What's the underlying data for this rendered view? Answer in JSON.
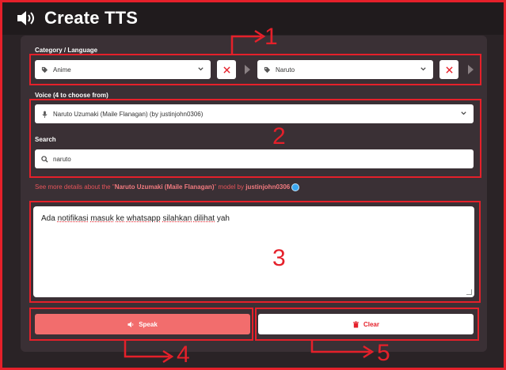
{
  "header": {
    "title": "Create TTS",
    "icon": "speaker-icon"
  },
  "category": {
    "label": "Category / Language",
    "category_value": "Anime",
    "subcategory_value": "Naruto"
  },
  "voice": {
    "label": "Voice (4 to choose from)",
    "value": "Naruto Uzumaki (Maile Flanagan) (by justinjohn0306)"
  },
  "search": {
    "label": "Search",
    "value": "naruto"
  },
  "details": {
    "prefix": "See more details about the \"",
    "model_name": "Naruto Uzumaki (Maile Flanagan)",
    "middle": "\" model by ",
    "owner": "justinjohn0306"
  },
  "text_input": {
    "words": [
      "Ada",
      "notifikasi",
      "masuk",
      "ke",
      "whatsapp",
      "silahkan",
      "dilihat",
      "yah"
    ]
  },
  "buttons": {
    "speak": "Speak",
    "clear": "Clear"
  },
  "annotations": {
    "n1": "1",
    "n2": "2",
    "n3": "3",
    "n4": "4",
    "n5": "5"
  },
  "colors": {
    "accent": "#e5202a",
    "speak_bg": "#f26d6d",
    "panel": "#3a3035",
    "background": "#2a2326"
  }
}
